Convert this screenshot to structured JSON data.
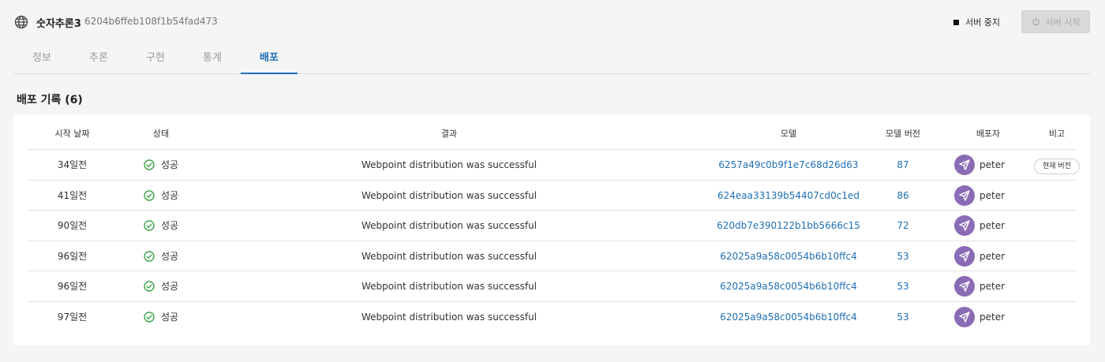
{
  "header": {
    "title": "숫자추론3",
    "id": "6204b6ffeb108f1b54fad473",
    "stop_label": "서버 중지",
    "start_label": "서버 시작"
  },
  "tabs": [
    {
      "label": "정보",
      "active": false
    },
    {
      "label": "추론",
      "active": false
    },
    {
      "label": "구현",
      "active": false
    },
    {
      "label": "통계",
      "active": false
    },
    {
      "label": "배포",
      "active": true
    }
  ],
  "section": {
    "title": "배포 기록 (6)"
  },
  "table": {
    "columns": [
      "시작 날짜",
      "상태",
      "결과",
      "모델",
      "모델 버전",
      "배포자",
      "비고"
    ],
    "rows": [
      {
        "date": "34일전",
        "status": "성공",
        "result": "Webpoint distribution was successful",
        "model": "6257a49c0b9f1e7c68d26d63",
        "version": "87",
        "deployer": "peter",
        "note": "현재 버전"
      },
      {
        "date": "41일전",
        "status": "성공",
        "result": "Webpoint distribution was successful",
        "model": "624eaa33139b54407cd0c1ed",
        "version": "86",
        "deployer": "peter",
        "note": ""
      },
      {
        "date": "90일전",
        "status": "성공",
        "result": "Webpoint distribution was successful",
        "model": "620db7e390122b1bb5666c15",
        "version": "72",
        "deployer": "peter",
        "note": ""
      },
      {
        "date": "96일전",
        "status": "성공",
        "result": "Webpoint distribution was successful",
        "model": "62025a9a58c0054b6b10ffc4",
        "version": "53",
        "deployer": "peter",
        "note": ""
      },
      {
        "date": "96일전",
        "status": "성공",
        "result": "Webpoint distribution was successful",
        "model": "62025a9a58c0054b6b10ffc4",
        "version": "53",
        "deployer": "peter",
        "note": ""
      },
      {
        "date": "97일전",
        "status": "성공",
        "result": "Webpoint distribution was successful",
        "model": "62025a9a58c0054b6b10ffc4",
        "version": "53",
        "deployer": "peter",
        "note": ""
      }
    ]
  },
  "colors": {
    "accent": "#1f6fb5",
    "success": "#3aa54a",
    "avatar": "#8a6bb5"
  },
  "icons": {
    "header": "globe-icon",
    "stop": "stop-square-icon",
    "start": "power-icon",
    "status": "check-circle-icon",
    "avatar": "paper-plane-icon"
  }
}
